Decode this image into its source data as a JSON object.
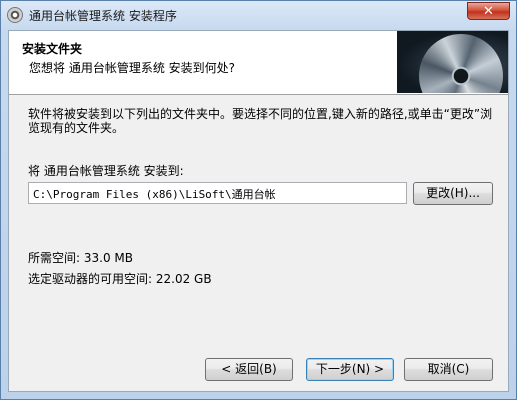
{
  "window": {
    "title": "通用台帐管理系统 安装程序",
    "close_label": "✕"
  },
  "header": {
    "title": "安装文件夹",
    "subtitle": "您想将 通用台帐管理系统 安装到何处?"
  },
  "body": {
    "instruction": "软件将被安装到以下列出的文件夹中。要选择不同的位置,键入新的路径,或单击“更改”浏览现有的文件夹。",
    "install_to_label": "将 通用台帐管理系统 安装到:",
    "install_path": "C:\\Program Files (x86)\\LiSoft\\通用台帐",
    "change_button": "更改(H)...",
    "space_required": "所需空间: 33.0 MB",
    "space_available": "选定驱动器的可用空间: 22.02 GB"
  },
  "footer": {
    "back_button": "< 返回(B)",
    "next_button": "下一步(N) >",
    "cancel_button": "取消(C)"
  },
  "colors": {
    "accent": "#3c7fb1",
    "close": "#c0321c",
    "titlebar": "#c6d9ef"
  },
  "icons": [
    "installer-disc-icon",
    "close-icon"
  ]
}
